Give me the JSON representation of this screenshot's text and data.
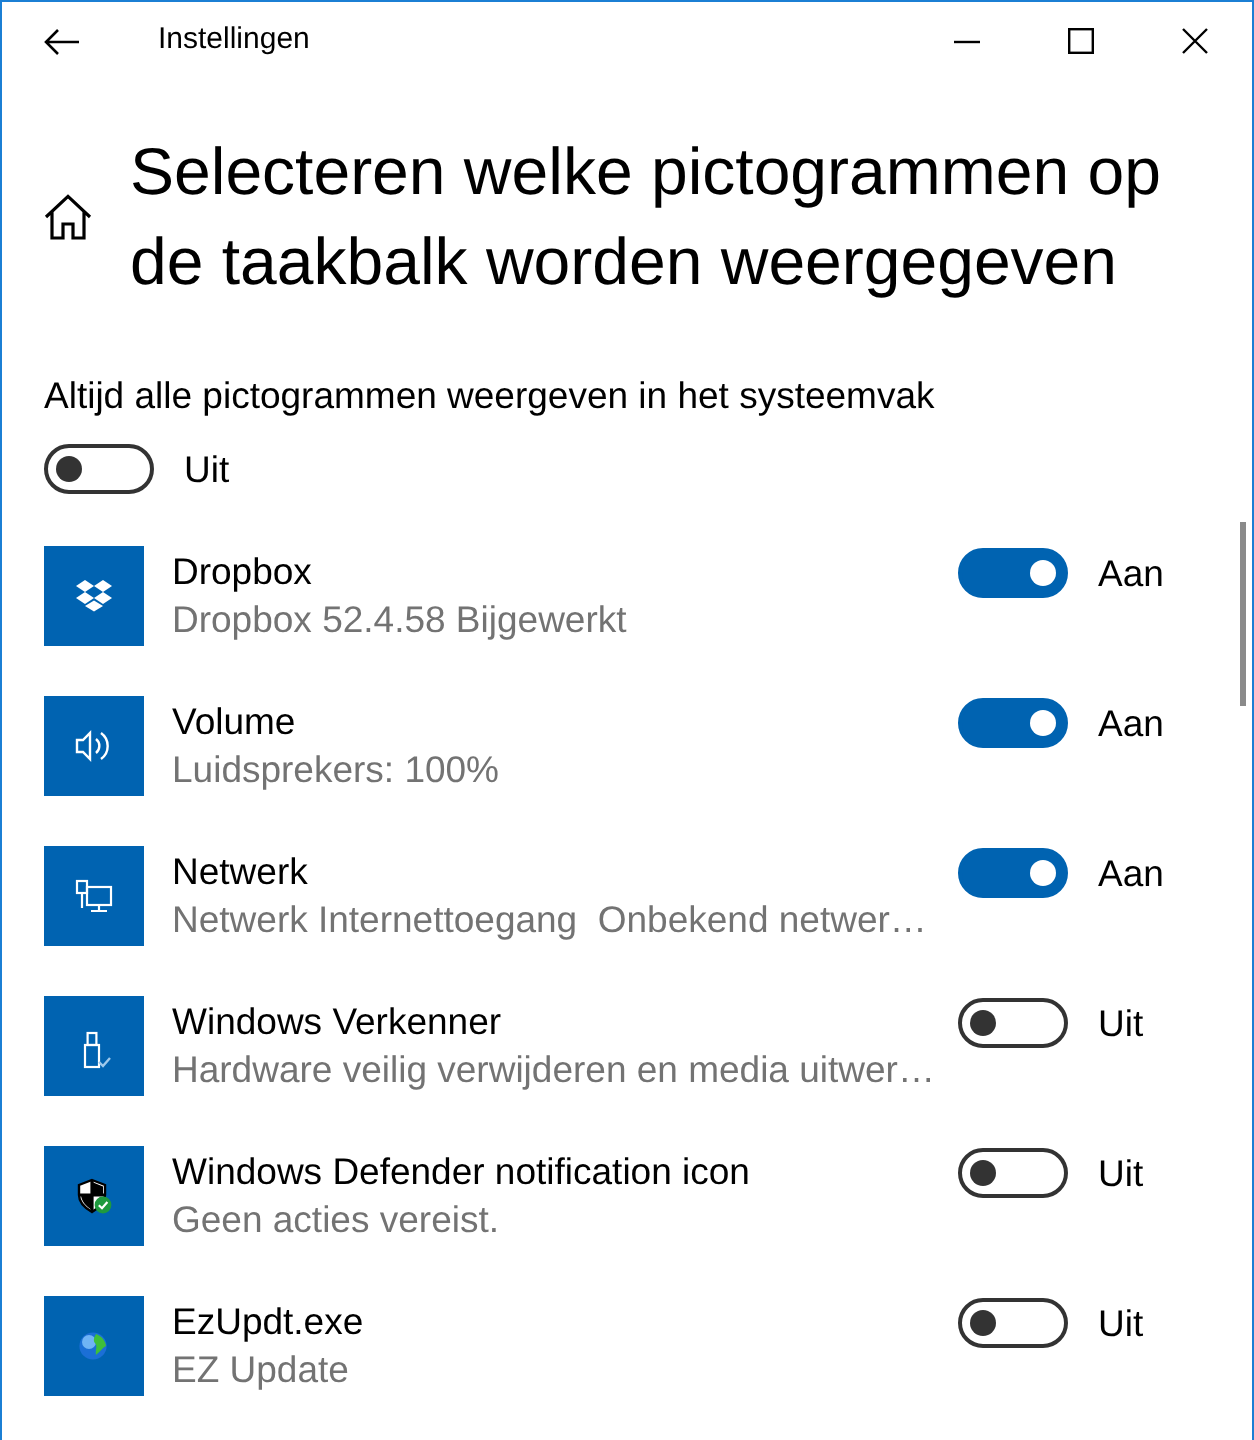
{
  "window": {
    "title": "Instellingen"
  },
  "page": {
    "title": "Selecteren welke pictogrammen op de taakbalk worden weergegeven"
  },
  "always_show": {
    "label": "Altijd alle pictogrammen weergeven in het systeemvak",
    "on": false,
    "state_label": "Uit"
  },
  "items": [
    {
      "name": "Dropbox",
      "detail": "Dropbox 52.4.58 Bijgewerkt",
      "on": true,
      "state_label": "Aan"
    },
    {
      "name": "Volume",
      "detail": "Luidsprekers: 100%",
      "on": true,
      "state_label": "Aan"
    },
    {
      "name": "Netwerk",
      "detail": "Netwerk Internettoegang  Onbekend netwer…",
      "on": true,
      "state_label": "Aan"
    },
    {
      "name": "Windows Verkenner",
      "detail": "Hardware veilig verwijderen en media uitwer…",
      "on": false,
      "state_label": "Uit"
    },
    {
      "name": "Windows Defender notification icon",
      "detail": "Geen acties vereist.",
      "on": false,
      "state_label": "Uit"
    },
    {
      "name": "EzUpdt.exe",
      "detail": "EZ Update",
      "on": false,
      "state_label": "Uit"
    }
  ]
}
